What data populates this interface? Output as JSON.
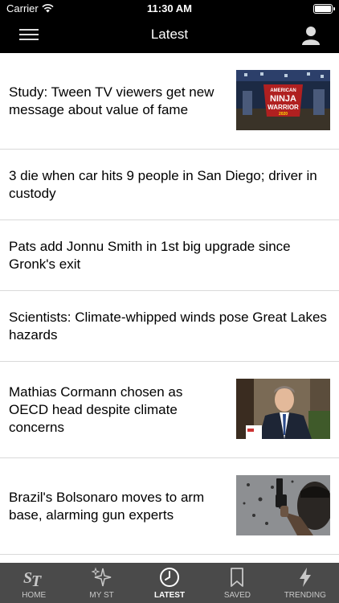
{
  "status_bar": {
    "carrier": "Carrier",
    "time": "11:30 AM"
  },
  "nav": {
    "title": "Latest"
  },
  "stories": [
    {
      "headline": "Study: Tween TV viewers get new message about value of fame",
      "thumbnail": "ninja-warrior-stage-image",
      "has_thumb": true
    },
    {
      "headline": "3 die when car hits 9 people in San Diego; driver in custody",
      "has_thumb": false
    },
    {
      "headline": "Pats add Jonnu Smith in 1st big upgrade since Gronk's exit",
      "has_thumb": false
    },
    {
      "headline": "Scientists: Climate-whipped winds pose Great Lakes hazards",
      "has_thumb": false
    },
    {
      "headline": "Mathias Cormann chosen as OECD head despite climate concerns",
      "thumbnail": "man-in-suit-interview-image",
      "has_thumb": true
    },
    {
      "headline": "Brazil's Bolsonaro moves to arm base, alarming gun experts",
      "thumbnail": "person-holding-handgun-image",
      "has_thumb": true
    }
  ],
  "thumb_overlay": {
    "line1": "AMERICAN",
    "line2": "NINJA",
    "line3": "WARRIOR",
    "line4": "2020"
  },
  "tabs": [
    {
      "label": "HOME",
      "icon": "st-logo-icon",
      "active": false
    },
    {
      "label": "MY ST",
      "icon": "sparkles-icon",
      "active": false
    },
    {
      "label": "LATEST",
      "icon": "clock-icon",
      "active": true
    },
    {
      "label": "SAVED",
      "icon": "bookmark-icon",
      "active": false
    },
    {
      "label": "TRENDING",
      "icon": "lightning-icon",
      "active": false
    }
  ],
  "colors": {
    "bar_background": "#000000",
    "tabbar_background": "#4a4a4a",
    "divider": "#d9d9d9"
  }
}
